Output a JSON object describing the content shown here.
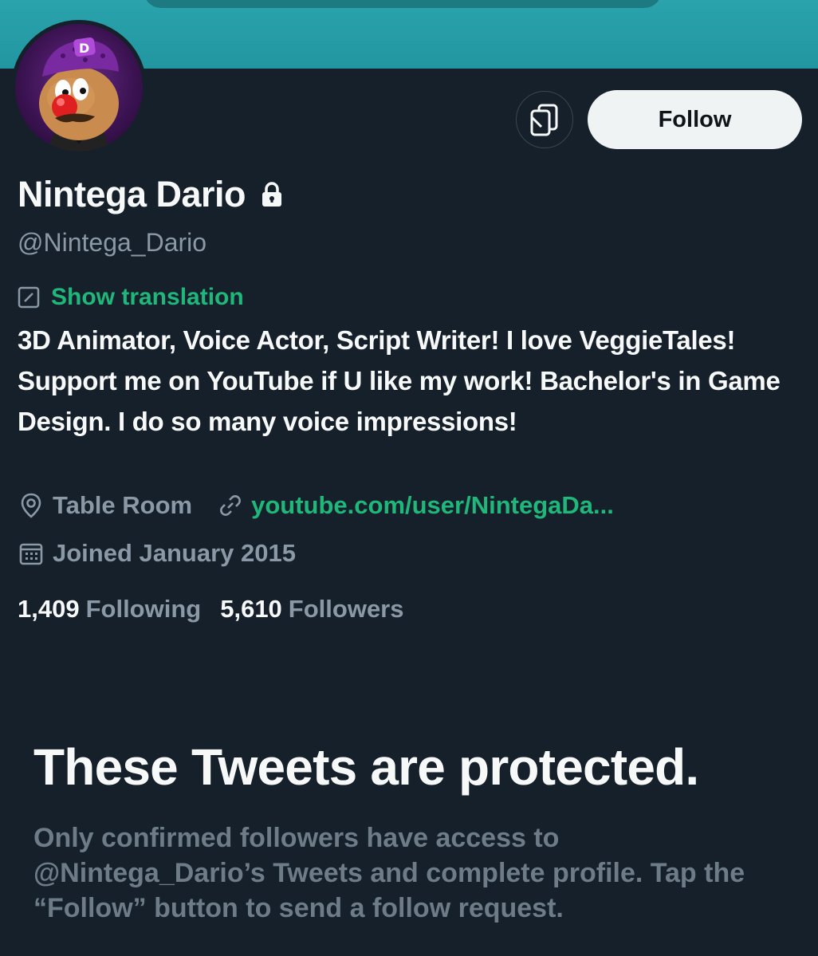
{
  "profile": {
    "name": "Nintega Dario",
    "handle": "@Nintega_Dario",
    "verified_lock": "lock-icon",
    "show_translation": "Show translation",
    "bio": "3D Animator, Voice Actor, Script Writer! I love VeggieTales! Support me on YouTube if U like my work! Bachelor's in Game Design. I do so many voice impressions!",
    "location": "Table Room",
    "link": "youtube.com/user/NintegaDa...",
    "joined": "Joined January 2015"
  },
  "stats": {
    "following_count": "1,409",
    "following_label": "Following",
    "followers_count": "5,610",
    "followers_label": "Followers"
  },
  "actions": {
    "follow_label": "Follow",
    "more_icon": "copy-profile-icon"
  },
  "protected": {
    "title": "These Tweets are protected.",
    "body": "Only confirmed followers have access to @Nintega_Dario’s Tweets and complete profile. Tap the “Follow” button to send a follow request."
  },
  "colors": {
    "background": "#15202b",
    "banner": "#2aa3ad",
    "accent_link": "#1fb87a",
    "secondary_text": "#8b98a5",
    "follow_button_bg": "#eff3f4"
  }
}
